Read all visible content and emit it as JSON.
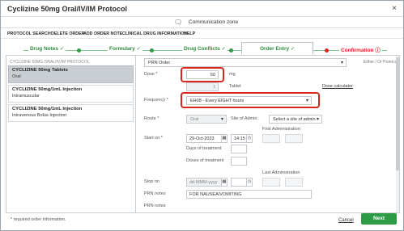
{
  "window": {
    "title": "Cyclizine 50mg Oral/IV/IM Protocol",
    "close": "×"
  },
  "comm": {
    "icon": "speech-bubble-icon",
    "label": "Communication zone"
  },
  "menu": [
    "PROTOCOL SEARCH",
    "DELETE ORDER",
    "ADD ORDER NOTE",
    "CLINICAL DRUG INFORMATION",
    "HELP"
  ],
  "steps": [
    {
      "label": "Drug Notes ✓"
    },
    {
      "label": "Formulary ✓"
    },
    {
      "label": "Drug Conflicts ✓"
    },
    {
      "label": "Order Entry ✓"
    },
    {
      "label": "Confirmation ⓘ"
    }
  ],
  "left": {
    "header": "CYCLIZINE 50MG ORAL/IV/IM PROTOCOL",
    "items": [
      {
        "name": "CYCLIZINE 50mg Tablets",
        "route": "Oral"
      },
      {
        "name": "CYCLIZINE 50mg/1mL Injection",
        "route": "Intramuscular"
      },
      {
        "name": "CYCLIZINE 50mg/1mL Injection",
        "route": "Intravenous Bolus Injection"
      }
    ]
  },
  "form": {
    "order_type": "PRN Order",
    "either_or": "Either / Or Protocol",
    "dose_label": "Dose *",
    "dose_value": "50",
    "dose_unit": "mg",
    "qty_value": "1",
    "qty_unit": "Tablet",
    "dose_calc": "Dose calculator",
    "freq_label": "Frequency *",
    "freq_value": "EH08 - Every EIGHT hours",
    "route_label": "Route *",
    "route_value": "Oral",
    "site_label": "Site of Admin.",
    "site_value": "Select a site of admin.",
    "start_label": "Start on *",
    "start_date": "29-Oct-2023",
    "start_time": "14:15",
    "first_admin": "First Administration",
    "days_label": "Days of treatment",
    "doses_label": "Doses of treatment",
    "stop_label": "Stop on",
    "stop_placeholder": "dd-MMM-yyyy",
    "last_admin": "Last Administration",
    "prn_label": "PRN notes",
    "prn_value": "FOR NAUSEA/VOMITING",
    "prn_label2": "PRN notes"
  },
  "footer": {
    "required": "* required order information.",
    "cancel": "Cancel",
    "next": "Next"
  },
  "colors": {
    "accent": "#2e9b46",
    "highlight": "#d9261c",
    "confirm": "#d22222"
  }
}
